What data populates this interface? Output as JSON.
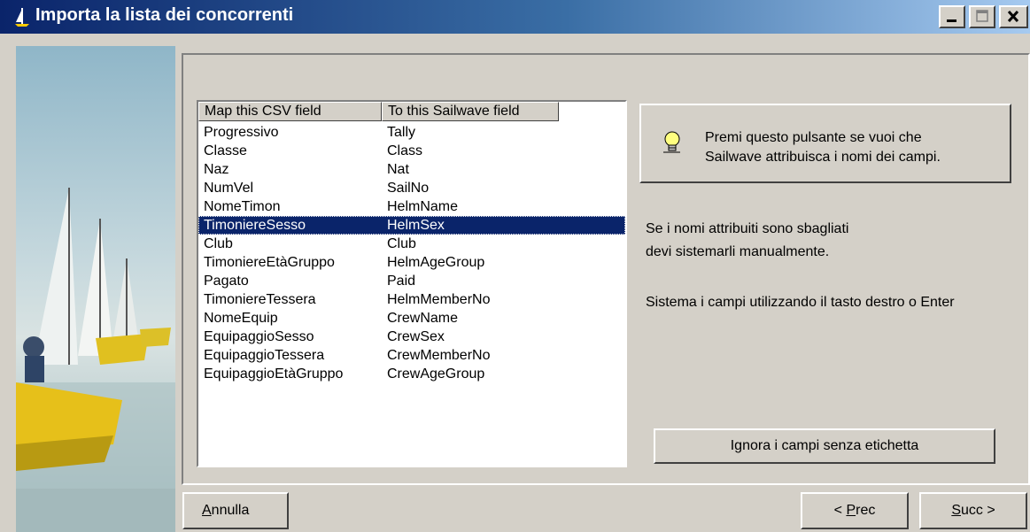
{
  "window": {
    "title": "Importa la lista dei concorrenti",
    "controls": [
      "minimize-icon",
      "maximize-icon",
      "close-icon"
    ]
  },
  "mapping_list": {
    "headers": [
      "Map this CSV field",
      "To this Sailwave field"
    ],
    "rows": [
      {
        "csv": "Progressivo",
        "sailwave": "Tally"
      },
      {
        "csv": "Classe",
        "sailwave": "Class"
      },
      {
        "csv": "Naz",
        "sailwave": "Nat"
      },
      {
        "csv": "NumVel",
        "sailwave": "SailNo"
      },
      {
        "csv": "NomeTimon",
        "sailwave": "HelmName"
      },
      {
        "csv": "TimoniereSesso",
        "sailwave": "HelmSex",
        "selected": true
      },
      {
        "csv": "Club",
        "sailwave": "Club"
      },
      {
        "csv": "TimoniereEtàGruppo",
        "sailwave": "HelmAgeGroup"
      },
      {
        "csv": "Pagato",
        "sailwave": "Paid"
      },
      {
        "csv": "TimoniereTessera",
        "sailwave": "HelmMemberNo"
      },
      {
        "csv": "NomeEquip",
        "sailwave": "CrewName"
      },
      {
        "csv": "EquipaggioSesso",
        "sailwave": "CrewSex"
      },
      {
        "csv": "EquipaggioTessera",
        "sailwave": "CrewMemberNo"
      },
      {
        "csv": "EquipaggioEtàGruppo",
        "sailwave": "CrewAgeGroup"
      }
    ]
  },
  "auto_name_button": {
    "line1": "Premi questo pulsante se vuoi che",
    "line2": "Sailwave attribuisca i nomi dei campi.",
    "icon": "lightbulb-icon"
  },
  "info": {
    "line1": "Se i nomi attribuiti sono sbagliati",
    "line2": "devi sistemarli manualmente.",
    "line3": "Sistema i campi utilizzando il tasto destro o Enter"
  },
  "buttons": {
    "ignore": "Ignora i campi senza etichetta",
    "cancel_accel": "A",
    "cancel_rest": "nnulla",
    "prev_pre": "< ",
    "prev_accel": "P",
    "prev_rest": "rec",
    "next_accel": "S",
    "next_rest": "ucc >"
  },
  "colors": {
    "selection": "#0a246a",
    "title_gradient_start": "#0a246a",
    "title_gradient_end": "#a6caf0",
    "face": "#d4d0c8"
  }
}
